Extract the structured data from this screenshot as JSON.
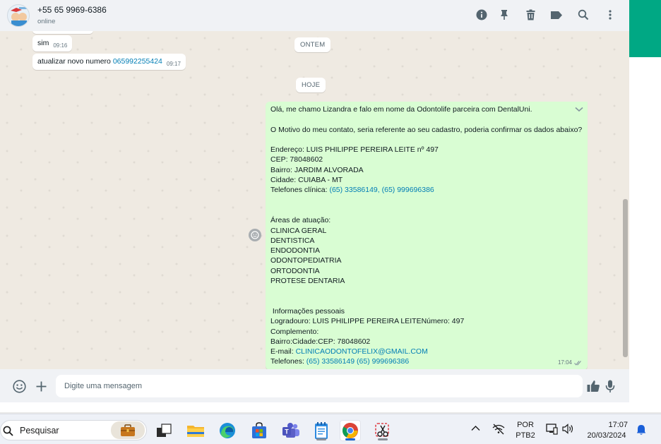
{
  "header": {
    "contact_name": "+55 65 9969-6386",
    "status": "online"
  },
  "messages_in": [
    {
      "text": "sim",
      "time": "09:16"
    },
    {
      "text": "atualizar novo numero ",
      "link": "065992255424",
      "time": "09:17"
    }
  ],
  "date_pills": {
    "yesterday": "ONTEM",
    "today": "HOJE"
  },
  "message_out": {
    "lines": [
      {
        "t": "Olá, me chamo Lizandra e falo em nome da Odontolife parceira com DentalUni."
      },
      {
        "t": ""
      },
      {
        "t": "O Motivo do meu contato, seria referente ao seu cadastro, poderia confirmar os dados abaixo?"
      },
      {
        "t": ""
      },
      {
        "t": "Endereço: LUIS PHILIPPE PEREIRA LEITE nº 497"
      },
      {
        "t": "CEP: 78048602"
      },
      {
        "t": "Bairro: JARDIM ALVORADA"
      },
      {
        "t": "Cidade: CUIABA - MT"
      },
      {
        "t": "Telefones clínica: ",
        "link": "(65) 33586149, (65) 999696386"
      },
      {
        "t": ""
      },
      {
        "t": ""
      },
      {
        "t": "Áreas de atuação:"
      },
      {
        "t": "CLINICA GERAL"
      },
      {
        "t": "DENTISTICA"
      },
      {
        "t": "ENDODONTIA"
      },
      {
        "t": "ODONTOPEDIATRIA"
      },
      {
        "t": "ORTODONTIA"
      },
      {
        "t": "PROTESE DENTARIA"
      },
      {
        "t": ""
      },
      {
        "t": ""
      },
      {
        "t": " Informações pessoais"
      },
      {
        "t": "Logradouro: LUIS PHILIPPE PEREIRA LEITENúmero: 497"
      },
      {
        "t": "Complemento:"
      },
      {
        "t": "Bairro:Cidade:CEP: 78048602"
      },
      {
        "t": "E-mail: ",
        "link": "CLINICAODONTOFELIX@GMAIL.COM"
      },
      {
        "t": "Telefones: ",
        "link": "(65) 33586149 (65) 999696386"
      }
    ],
    "time": "17:04"
  },
  "composer": {
    "placeholder": "Digite uma mensagem"
  },
  "taskbar": {
    "search_label": "Pesquisar",
    "lang_line1": "POR",
    "lang_line2": "PTB2",
    "clock_time": "17:07",
    "clock_date": "20/03/2024"
  },
  "colors": {
    "teal": "#00a884",
    "outgoing_bubble": "#d9fdd3",
    "link": "#027eb5",
    "chat_bg": "#efeae2"
  }
}
